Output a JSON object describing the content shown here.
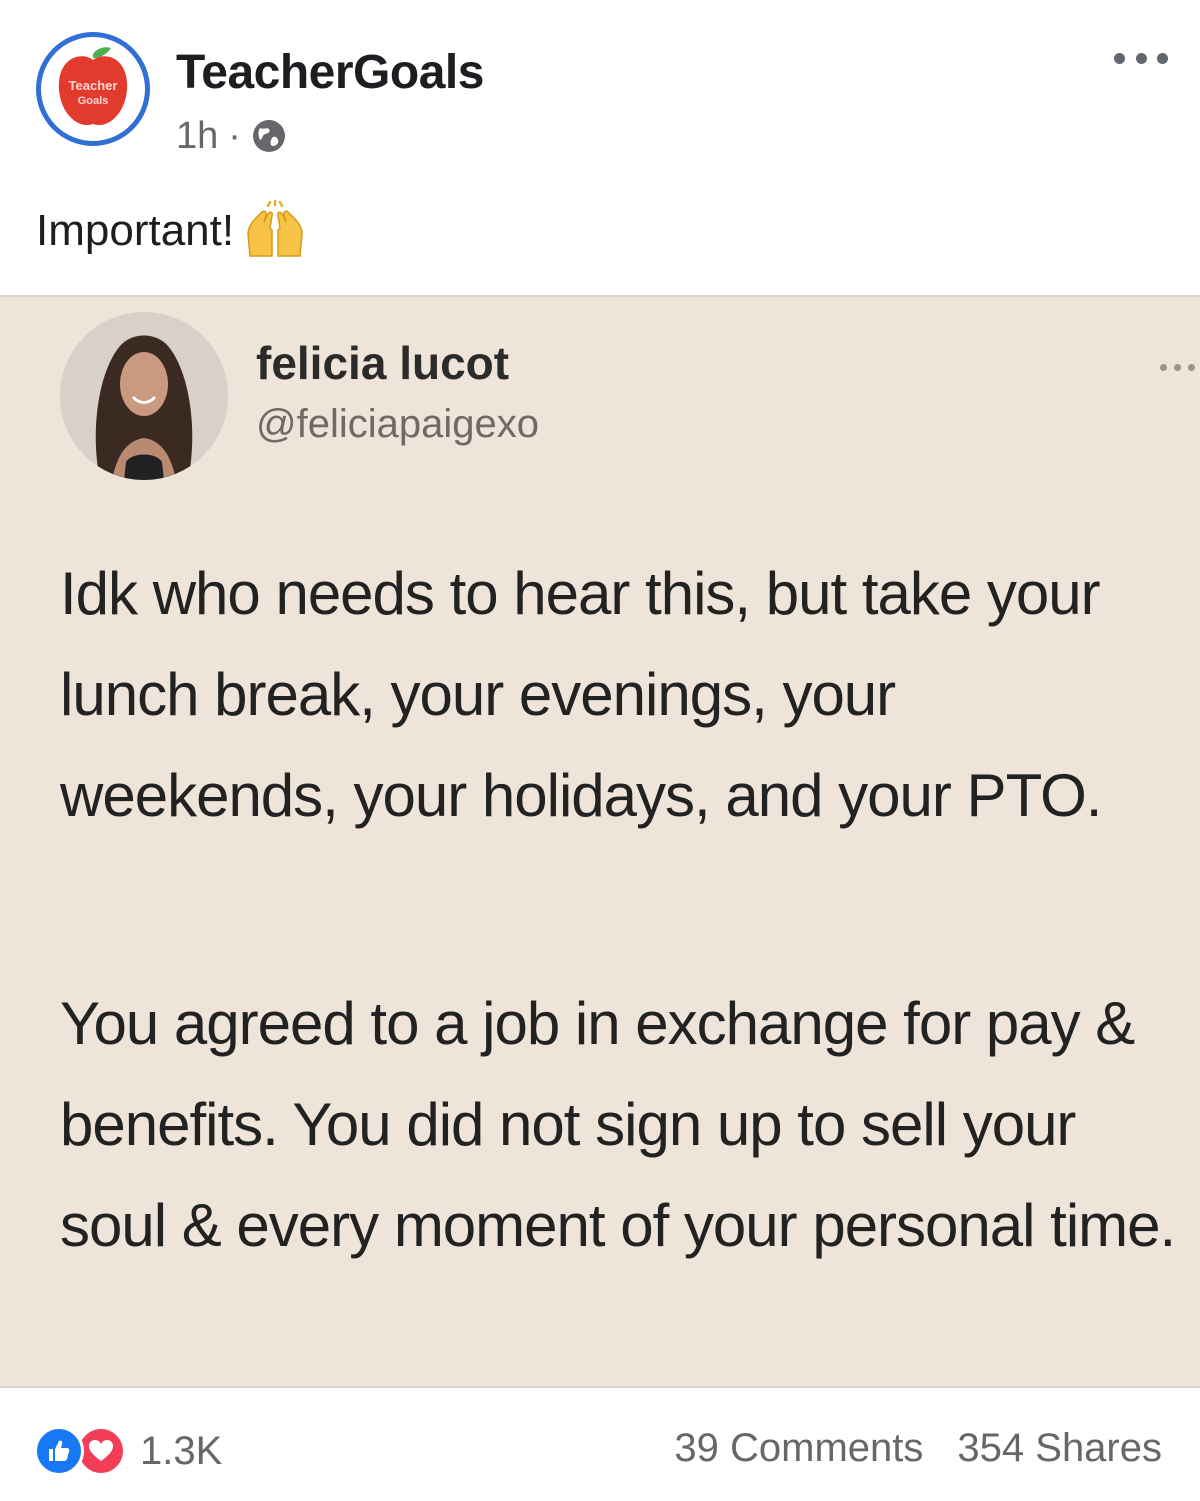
{
  "post": {
    "page_name": "TeacherGoals",
    "logo_text_line1": "Teacher",
    "logo_text_line2": "Goals",
    "time": "1h",
    "separator": "·",
    "audience_icon": "globe-icon",
    "caption": "Important!",
    "caption_emoji": "raising-hands-emoji"
  },
  "tweet": {
    "name": "felicia lucot",
    "handle": "@feliciapaigexo",
    "paragraph_1": "Idk who needs to hear this, but take your lunch break, your evenings, your weekends, your holidays, and your PTO.",
    "paragraph_2": "You agreed to a job in exchange for pay & benefits. You did not sign up to sell your soul & every moment of your personal time."
  },
  "footer": {
    "reaction_icons": [
      "like-icon",
      "love-icon"
    ],
    "reaction_count": "1.3K",
    "comments": "39 Comments",
    "shares": "354 Shares"
  },
  "colors": {
    "facebook_blue": "#1877f2",
    "love_red": "#f33e58",
    "avatar_ring": "#2f6fd6",
    "tweet_background": "#efe4d9",
    "meta_gray": "#65676b"
  }
}
